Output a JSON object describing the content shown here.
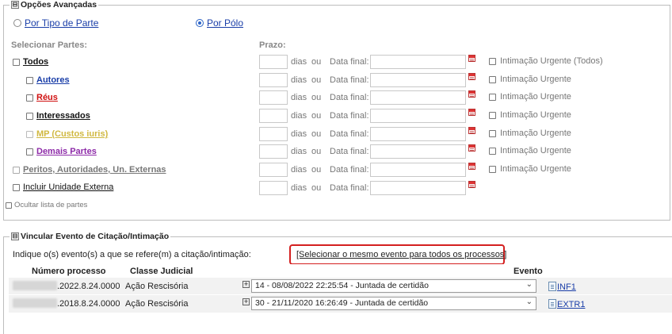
{
  "advanced": {
    "legend": "Opções Avançadas",
    "toggle": "⊟",
    "radio_tipo_parte": "Por Tipo de Parte",
    "radio_polo": "Por Pólo",
    "selecionar_partes": "Selecionar Partes:",
    "prazo": "Prazo:",
    "dias": "dias",
    "ou": "ou",
    "data_final": "Data final:",
    "rows": [
      {
        "label": "Todos",
        "urgent": "Intimação Urgente (Todos)"
      },
      {
        "label": "Autores",
        "urgent": "Intimação Urgente"
      },
      {
        "label": "Réus",
        "urgent": "Intimação Urgente"
      },
      {
        "label": "Interessados",
        "urgent": "Intimação Urgente"
      },
      {
        "label": "MP (Custos iuris)",
        "urgent": "Intimação Urgente"
      },
      {
        "label": "Demais Partes",
        "urgent": "Intimação Urgente"
      },
      {
        "label": "Peritos, Autoridades, Un. Externas",
        "urgent": "Intimação Urgente"
      },
      {
        "label": "Incluir Unidade Externa",
        "urgent": ""
      }
    ],
    "ocultar": "Ocultar lista de partes"
  },
  "vincular": {
    "legend": "Vincular Evento de Citação/Intimação",
    "toggle": "⊟",
    "indique": "Indique o(s) evento(s) a que se refere(m) a citação/intimação:",
    "selecionar_mesmo": "[Selecionar o mesmo evento para todos os processos]",
    "headers": {
      "numero": "Número processo",
      "classe": "Classe Judicial",
      "evento": "Evento"
    },
    "rows": [
      {
        "numero": ".2022.8.24.0000",
        "classe": "Ação Rescisória",
        "evento": "14 - 08/08/2022 22:25:54 - Juntada de certidão",
        "doc": "INF1"
      },
      {
        "numero": ".2018.8.24.0000",
        "classe": "Ação Rescisória",
        "evento": "30 - 21/11/2020 16:26:49 - Juntada de certidão",
        "doc": "EXTR1"
      }
    ]
  }
}
